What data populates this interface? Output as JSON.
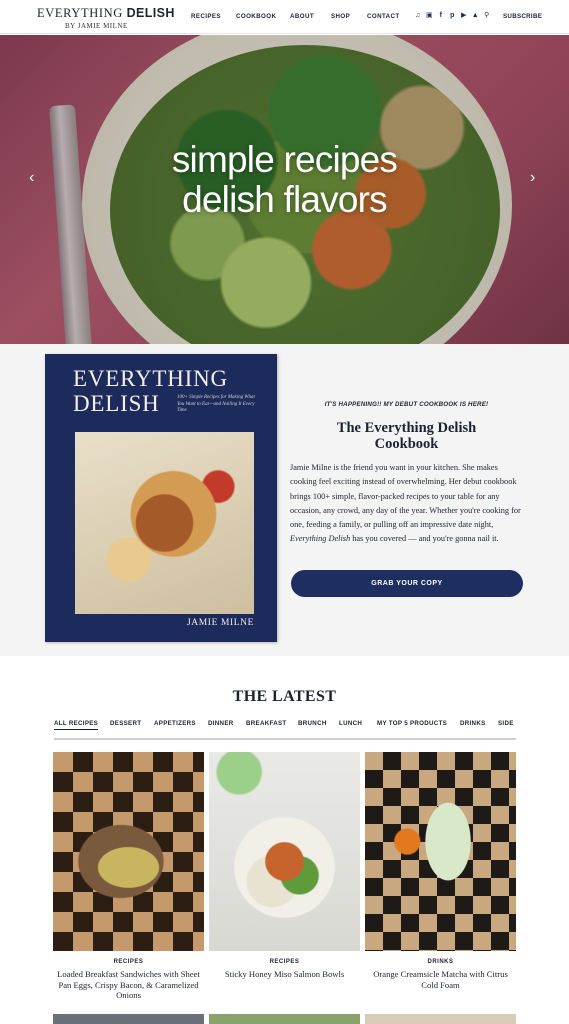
{
  "header": {
    "logo_main_light": "EVERYTHING ",
    "logo_main_bold": "DELISH",
    "logo_sub": "BY JAMIE MILNE",
    "nav": [
      "RECIPES",
      "COOKBOOK",
      "ABOUT",
      "SHOP",
      "CONTACT"
    ],
    "social_icons": [
      "tiktok-icon",
      "instagram-icon",
      "facebook-icon",
      "pinterest-icon",
      "youtube-icon",
      "notification-bell-icon",
      "search-icon"
    ],
    "subscribe": "SUBSCRIBE"
  },
  "hero": {
    "line1": "simple recipes",
    "line2": "delish flavors",
    "prev_icon": "chevron-left-icon",
    "next_icon": "chevron-right-icon"
  },
  "cookbook": {
    "book_title_line1": "EVERYTHING",
    "book_title_line2": "DELISH",
    "book_tagline": "100+ Simple Recipes for Making What You Want to Eat—and Nailing It Every Time",
    "book_author": "JAMIE MILNE",
    "kicker": "IT'S HAPPENING!! MY DEBUT COOKBOOK IS HERE!",
    "heading_line1": "The Everything Delish",
    "heading_line2": "Cookbook",
    "body_before": "Jamie Milne is the friend you want in your kitchen. She makes cooking feel exciting instead of overwhelming. Her debut cookbook brings 100+ simple, flavor-packed recipes to your table for any occasion, any crowd, any day of the year. Whether you're cooking for one, feeding a family, or pulling off an impressive date night, ",
    "body_italic": "Everything Delish",
    "body_after": " has you covered — and you're gonna nail it.",
    "button": "GRAB YOUR COPY"
  },
  "latest": {
    "title": "THE LATEST",
    "tabs": [
      "ALL RECIPES",
      "DESSERT",
      "APPETIZERS",
      "DINNER",
      "BREAKFAST",
      "BRUNCH",
      "LUNCH",
      "MY TOP 5 PRODUCTS",
      "DRINKS",
      "SIDE"
    ],
    "active_tab": "ALL RECIPES",
    "cards": [
      {
        "category": "RECIPES",
        "title": "Loaded Breakfast Sandwiches with Sheet Pan Eggs, Crispy Bacon, & Caramelized Onions"
      },
      {
        "category": "RECIPES",
        "title": "Sticky Honey Miso Salmon Bowls"
      },
      {
        "category": "DRINKS",
        "title": "Orange Creamsicle Matcha with Citrus Cold Foam"
      }
    ]
  },
  "colors": {
    "navy": "#1f2e60",
    "text": "#1d2231",
    "cookbook_bg": "#f4f4f4"
  }
}
